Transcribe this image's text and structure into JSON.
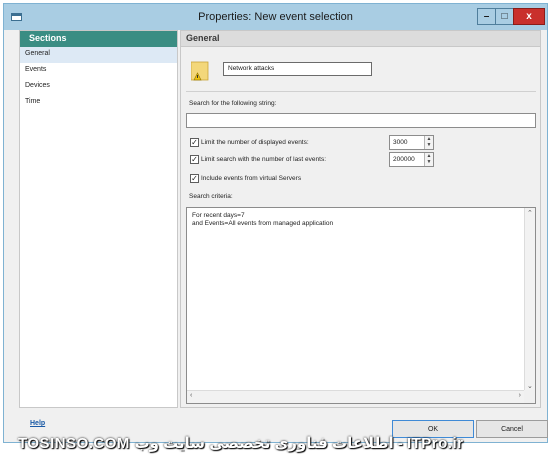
{
  "window": {
    "title": "Properties: New event selection"
  },
  "sections": {
    "header": "Sections",
    "items": [
      {
        "label": "General"
      },
      {
        "label": "Events"
      },
      {
        "label": "Devices"
      },
      {
        "label": "Time"
      }
    ]
  },
  "general": {
    "header": "General",
    "name_value": "Network attacks",
    "search_label": "Search for the following string:",
    "search_value": "",
    "options": [
      {
        "label": "Limit the number of displayed events:",
        "checked": true,
        "value": "3000"
      },
      {
        "label": "Limit search with the number of last events:",
        "checked": true,
        "value": "200000"
      },
      {
        "label": "Include events from virtual Servers",
        "checked": true
      }
    ],
    "criteria_label": "Search criteria:",
    "criteria_text": "For recent days=7\nand Events=All events from managed application"
  },
  "footer": {
    "help": "Help",
    "ok": "OK",
    "cancel": "Cancel",
    "watermark": "TOSINSO.COM  اطلاعات فناوری تخصصی سایت وب - ITPro.ir"
  },
  "colors": {
    "sections_header": "#3a8d83",
    "titlebar": "#a9cde3",
    "close": "#c9302c"
  }
}
